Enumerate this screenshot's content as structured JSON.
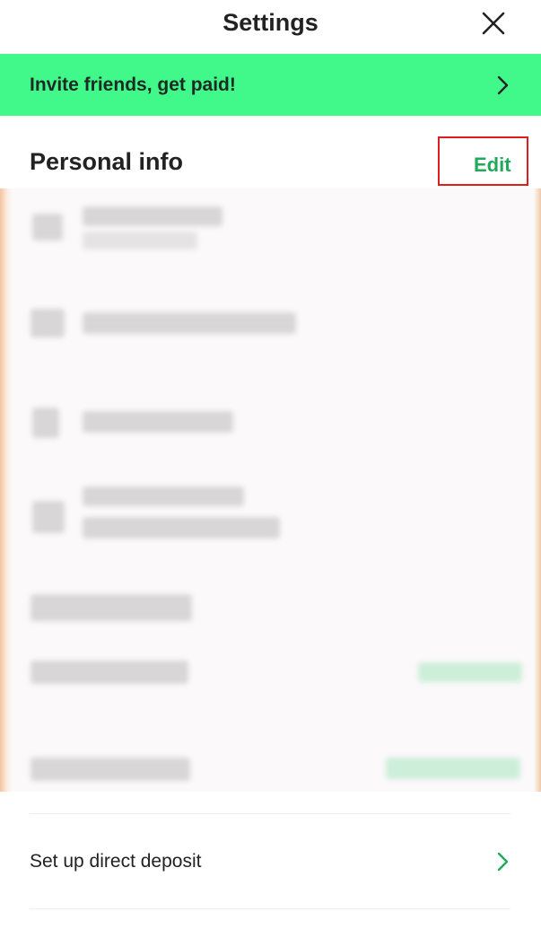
{
  "header": {
    "title": "Settings",
    "close_icon": "close-icon"
  },
  "banner": {
    "label": "Invite friends, get paid!",
    "icon": "chevron-right-icon",
    "color": "#41f98a"
  },
  "personal_info": {
    "heading": "Personal info",
    "edit_label": "Edit",
    "accent": "#1faa59"
  },
  "footer": {
    "direct_deposit_label": "Set up direct deposit",
    "icon": "chevron-right-icon"
  }
}
